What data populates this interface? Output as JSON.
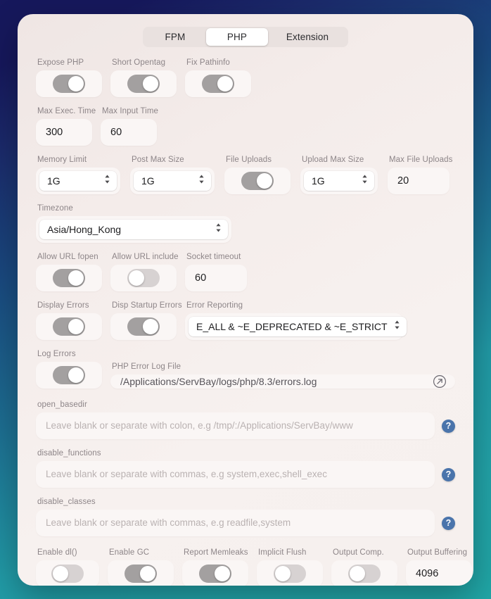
{
  "tabs": [
    {
      "label": "FPM",
      "active": false
    },
    {
      "label": "PHP",
      "active": true
    },
    {
      "label": "Extension",
      "active": false
    }
  ],
  "colors": {
    "accent_help": "#4a74ab",
    "toggle_on": "#a3a0a0",
    "toggle_off": "#d7d2d2",
    "panel": "#f4ecea",
    "tile": "#faf6f5"
  },
  "row_toggles_1": [
    {
      "label": "Expose PHP",
      "state": "on"
    },
    {
      "label": "Short Opentag",
      "state": "on"
    },
    {
      "label": "Fix Pathinfo",
      "state": "on"
    }
  ],
  "row_times": [
    {
      "label": "Max Exec. Time",
      "value": "300"
    },
    {
      "label": "Max Input Time",
      "value": "60"
    }
  ],
  "row_memory": {
    "memory_limit": {
      "label": "Memory Limit",
      "value": "1G"
    },
    "post_max_size": {
      "label": "Post Max Size",
      "value": "1G"
    },
    "file_uploads": {
      "label": "File Uploads",
      "state": "on"
    },
    "upload_max_size": {
      "label": "Upload Max Size",
      "value": "1G"
    },
    "max_file_uploads": {
      "label": "Max File Uploads",
      "value": "20"
    }
  },
  "timezone": {
    "label": "Timezone",
    "value": "Asia/Hong_Kong"
  },
  "row_url": {
    "allow_url_fopen": {
      "label": "Allow URL fopen",
      "state": "on"
    },
    "allow_url_include": {
      "label": "Allow URL include",
      "state": "off"
    },
    "socket_timeout": {
      "label": "Socket timeout",
      "value": "60"
    }
  },
  "row_errors": {
    "display_errors": {
      "label": "Display Errors",
      "state": "on"
    },
    "disp_startup_errors": {
      "label": "Disp Startup Errors",
      "state": "on"
    },
    "error_reporting": {
      "label": "Error Reporting",
      "value": "E_ALL & ~E_DEPRECATED & ~E_STRICT"
    }
  },
  "row_log": {
    "log_errors": {
      "label": "Log Errors",
      "state": "on"
    },
    "php_error_log": {
      "label": "PHP Error Log File",
      "value": "/Applications/ServBay/logs/php/8.3/errors.log",
      "open_icon": "open-external-icon"
    }
  },
  "text_fields": [
    {
      "label": "open_basedir",
      "value": "",
      "placeholder": "Leave blank or separate with colon, e.g /tmp/:/Applications/ServBay/www",
      "help_icon": "help-icon"
    },
    {
      "label": "disable_functions",
      "value": "",
      "placeholder": "Leave blank or separate with commas, e.g system,exec,shell_exec",
      "help_icon": "help-icon"
    },
    {
      "label": "disable_classes",
      "value": "",
      "placeholder": "Leave blank or separate with commas, e.g readfile,system",
      "help_icon": "help-icon"
    }
  ],
  "row_bottom": {
    "enable_dl": {
      "label": "Enable dl()",
      "state": "off"
    },
    "enable_gc": {
      "label": "Enable GC",
      "state": "on"
    },
    "report_memleaks": {
      "label": "Report Memleaks",
      "state": "on"
    },
    "implicit_flush": {
      "label": "Implicit Flush",
      "state": "off"
    },
    "output_comp": {
      "label": "Output Comp.",
      "state": "off"
    },
    "output_buffering": {
      "label": "Output Buffering",
      "value": "4096"
    }
  }
}
